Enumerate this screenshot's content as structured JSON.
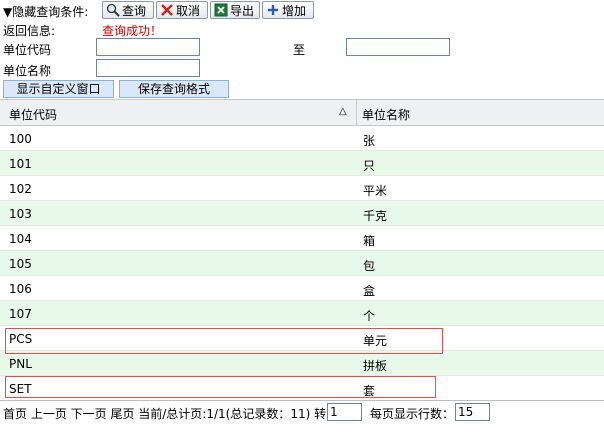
{
  "toolbar": {
    "toggle_label": "▼隐藏查询条件:",
    "query_label": "查询",
    "cancel_label": "取消",
    "export_label": "导出",
    "add_label": "增加"
  },
  "status": {
    "label": "返回信息:",
    "message": "查询成功！"
  },
  "filters": {
    "code_label": "单位代码",
    "to_label": "至",
    "name_label": "单位名称",
    "code_from_value": "",
    "code_to_value": "",
    "name_value": ""
  },
  "actions": {
    "custom_window": "显示自定义窗口",
    "save_format": "保存查询格式"
  },
  "grid": {
    "col_code": "单位代码",
    "sort_indicator": "△",
    "col_name": "单位名称",
    "rows": [
      {
        "code": "100",
        "name": "张"
      },
      {
        "code": "101",
        "name": "只"
      },
      {
        "code": "102",
        "name": "平米"
      },
      {
        "code": "103",
        "name": "千克"
      },
      {
        "code": "104",
        "name": "箱"
      },
      {
        "code": "105",
        "name": "包"
      },
      {
        "code": "106",
        "name": "盒"
      },
      {
        "code": "107",
        "name": "个"
      },
      {
        "code": "PCS",
        "name": "单元"
      },
      {
        "code": "PNL",
        "name": "拼板"
      },
      {
        "code": "SET",
        "name": "套"
      }
    ]
  },
  "pager": {
    "nav_text": "首页 上一页 下一页 尾页 当前/总计页:1/1(总记录数：11) 转到",
    "goto_value": "1",
    "rows_label": "每页显示行数：",
    "rows_value": "15"
  },
  "colors": {
    "alt_row": "#e9f9e9",
    "highlight": "#e05050",
    "message": "#d40000"
  }
}
